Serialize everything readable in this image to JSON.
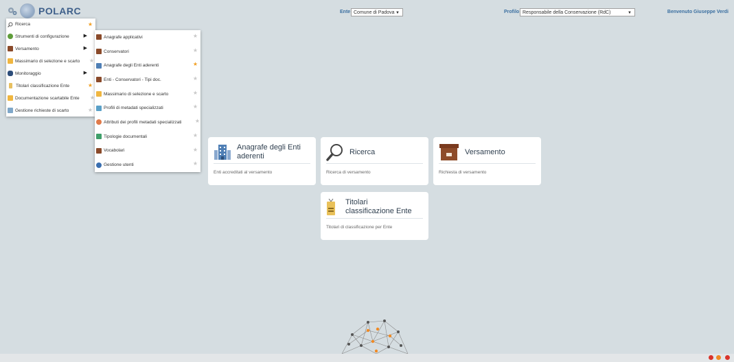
{
  "header": {
    "app_title": "POLARC",
    "ente_label": "Ente",
    "ente_value": "Comune di Padova",
    "profilo_label": "Profilo",
    "profilo_value": "Responsabile della Conservazione (RdC)",
    "welcome": "Benvenuto Giuseppe Verdi"
  },
  "menu": {
    "items": [
      {
        "label": "Ricerca",
        "icon": "search-icon",
        "star": true,
        "submenu": false
      },
      {
        "label": "Strumenti di configurazione",
        "icon": "tools-icon",
        "star": true,
        "submenu": true
      },
      {
        "label": "Versamento",
        "icon": "box-icon",
        "star": true,
        "submenu": true
      },
      {
        "label": "Massimario di selezione e scarto",
        "icon": "folder-icon",
        "star": false,
        "submenu": true
      },
      {
        "label": "Monitoraggio",
        "icon": "binoculars-icon",
        "star": false,
        "submenu": true
      },
      {
        "label": "Titolari classificazione Ente",
        "icon": "badge-icon",
        "star": true,
        "submenu": false
      },
      {
        "label": "Documentazione scartabile Ente",
        "icon": "folder-icon",
        "star": false,
        "submenu": false
      },
      {
        "label": "Gestione richieste di scarto",
        "icon": "screen-icon",
        "star": false,
        "submenu": false
      }
    ]
  },
  "submenu": {
    "items": [
      {
        "label": "Anagrafe applicativi",
        "icon": "book-icon",
        "star": false
      },
      {
        "label": "Conservatori",
        "icon": "box-icon",
        "star": false
      },
      {
        "label": "Anagrafe degli Enti aderenti",
        "icon": "building-icon",
        "star": true
      },
      {
        "label": "Enti - Conservatori - Tipi doc.",
        "icon": "box-icon",
        "star": false
      },
      {
        "label": "Massimario di selezione e scarto",
        "icon": "folder-icon",
        "star": false
      },
      {
        "label": "Profili di metadati specializzati",
        "icon": "chart-icon",
        "star": false
      },
      {
        "label": "Attributi dei profili metadati specializzati",
        "icon": "puzzle-icon",
        "star": false
      },
      {
        "label": "Tipologie documentali",
        "icon": "grid-icon",
        "star": false
      },
      {
        "label": "Vocabolari",
        "icon": "book-icon",
        "star": false
      },
      {
        "label": "Gestione utenti",
        "icon": "user-icon",
        "star": false
      }
    ]
  },
  "cards": [
    {
      "title_line1": "Anagrafe degli Enti",
      "title_line2": "aderenti",
      "desc": "Enti accreditati al versamento",
      "icon": "building-icon"
    },
    {
      "title_line1": "Ricerca",
      "title_line2": "",
      "desc": "Ricerca di versamento",
      "icon": "search-icon"
    },
    {
      "title_line1": "Versamento",
      "title_line2": "",
      "desc": "Richiesta di versamento",
      "icon": "box-icon"
    },
    {
      "title_line1": "Titolari",
      "title_line2": "classificazione Ente",
      "desc": "Titolari di classificazione per Ente",
      "icon": "badge-icon"
    }
  ],
  "colors": {
    "background": "#d5dde1",
    "accent": "#3b6fa0",
    "star_active": "#f2a024",
    "star_inactive": "#c9c9c9"
  }
}
